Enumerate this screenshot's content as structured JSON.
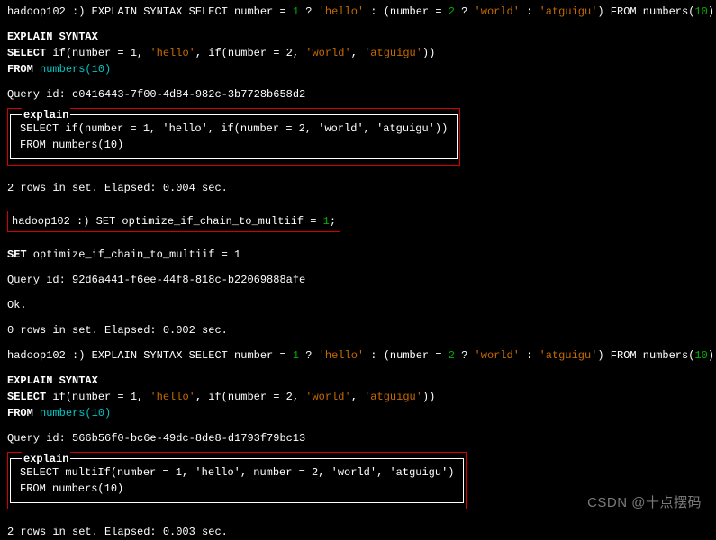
{
  "prompt": "hadoop102 :) ",
  "cmd1": {
    "pre": "EXPLAIN SYNTAX SELECT number = ",
    "n1": "1",
    "q": " ? ",
    "s1": "'hello'",
    "colon": " : (number = ",
    "n2": "2",
    "s2": "'world'",
    "colon2": " : ",
    "s3": "'atguigu'",
    "tail": ") FROM numbers(",
    "n3": "10",
    "end": ");"
  },
  "echo1": {
    "l1a": "EXPLAIN SYNTAX",
    "l2a": "SELECT",
    "l2b": " if(number = 1, ",
    "l2c": "'hello'",
    "l2d": ", if(number = 2, ",
    "l2e": "'world'",
    "l2f": ", ",
    "l2g": "'atguigu'",
    "l2h": "))",
    "l3a": "FROM",
    "l3b": " numbers(10)"
  },
  "qid1_label": "Query id: ",
  "qid1": "c0416443-7f00-4d84-982c-3b7728b658d2",
  "explain_legend": "explain",
  "explain1_l1": "SELECT if(number = 1, 'hello', if(number = 2, 'world', 'atguigu'))",
  "explain1_l2": "FROM numbers(10)",
  "rows1": "2 rows in set. Elapsed: 0.004 sec.",
  "cmd2_pre": "SET optimize_if_chain_to_multiif = ",
  "cmd2_n": "1",
  "cmd2_end": ";",
  "echo2_a": "SET",
  "echo2_b": " optimize_if_chain_to_multiif = 1",
  "qid2": "92d6a441-f6ee-44f8-818c-b22069888afe",
  "ok": "Ok.",
  "rows2": "0 rows in set. Elapsed: 0.002 sec.",
  "qid3": "566b56f0-bc6e-49dc-8de8-d1793f79bc13",
  "explain2_l1": "SELECT multiIf(number = 1, 'hello', number = 2, 'world', 'atguigu')",
  "explain2_l2": "FROM numbers(10)",
  "rows3": "2 rows in set. Elapsed: 0.003 sec.",
  "watermark": "CSDN @十点摆码"
}
